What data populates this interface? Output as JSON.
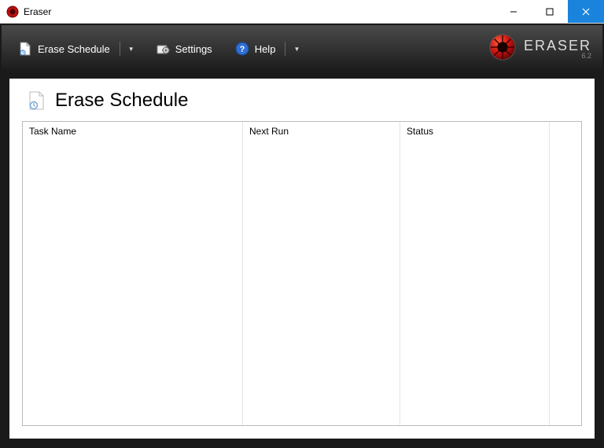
{
  "window": {
    "title": "Eraser"
  },
  "toolbar": {
    "erase_schedule_label": "Erase Schedule",
    "settings_label": "Settings",
    "help_label": "Help"
  },
  "brand": {
    "name": "ERASER",
    "version": "6.2"
  },
  "page": {
    "title": "Erase Schedule"
  },
  "columns": {
    "task_name": "Task Name",
    "next_run": "Next Run",
    "status": "Status"
  },
  "rows": []
}
